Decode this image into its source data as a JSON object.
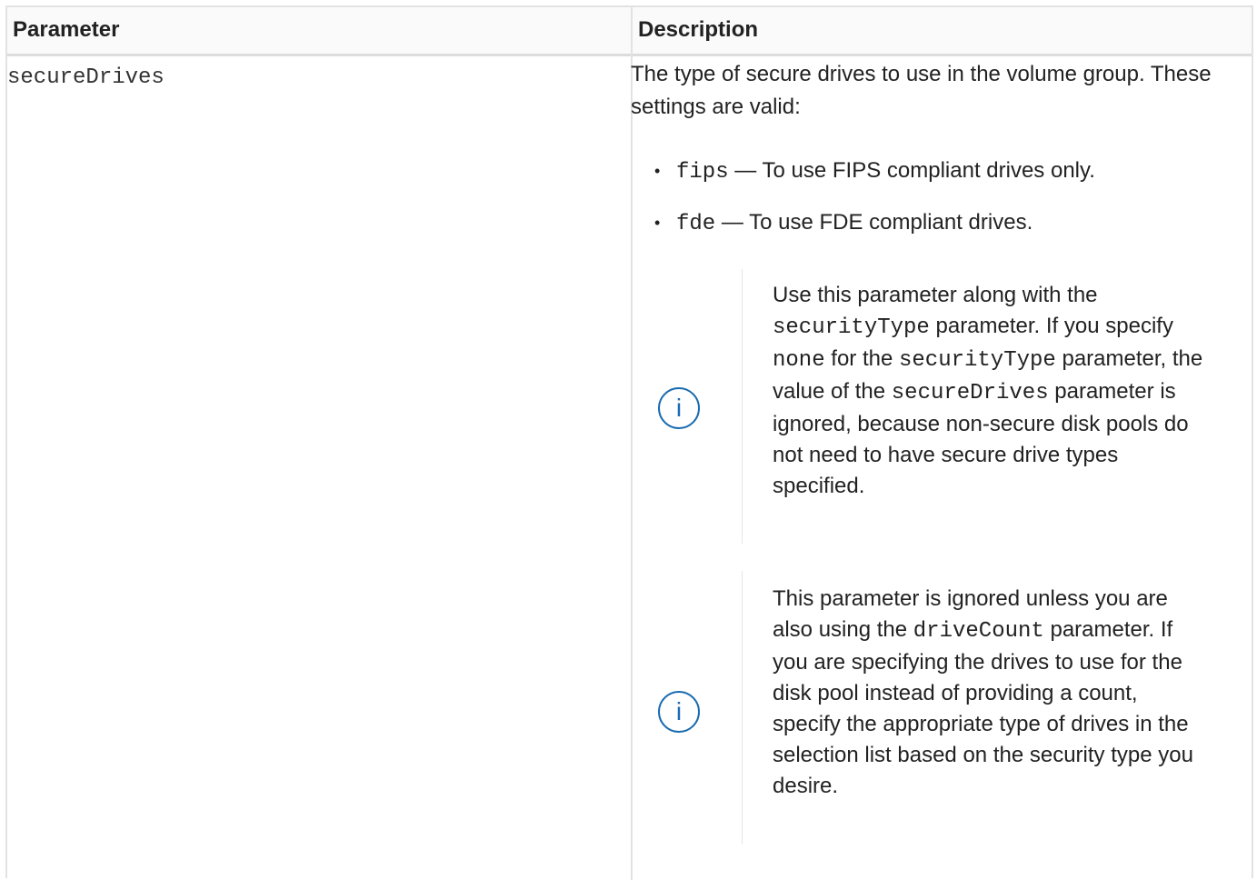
{
  "table": {
    "headers": {
      "parameter": "Parameter",
      "description": "Description"
    },
    "row": {
      "parameter_name": "secureDrives",
      "intro": "The type of secure drives to use in the volume group. These settings are valid:",
      "options": [
        {
          "code": "fips",
          "text": "— To use FIPS compliant drives only."
        },
        {
          "code": "fde",
          "text": "— To use FDE compliant drives."
        }
      ],
      "notes": [
        {
          "icon": "info-icon",
          "parts": [
            "Use this parameter along with the ",
            "securityType",
            " parameter. If you specify ",
            "none",
            " for the ",
            "securityType",
            " parameter, the value of the ",
            "secureDrives",
            " parameter is ignored, because non-secure disk pools do not need to have secure drive types specified."
          ]
        },
        {
          "icon": "info-icon",
          "parts": [
            "This parameter is ignored unless you are also using the ",
            "driveCount",
            " parameter. If you are specifying the drives to use for the disk pool instead of providing a count, specify the appropriate type of drives in the selection list based on the security type you desire."
          ]
        }
      ]
    }
  },
  "colors": {
    "icon": "#1a6bb0",
    "border": "#e2e2e2",
    "text": "#222222"
  }
}
